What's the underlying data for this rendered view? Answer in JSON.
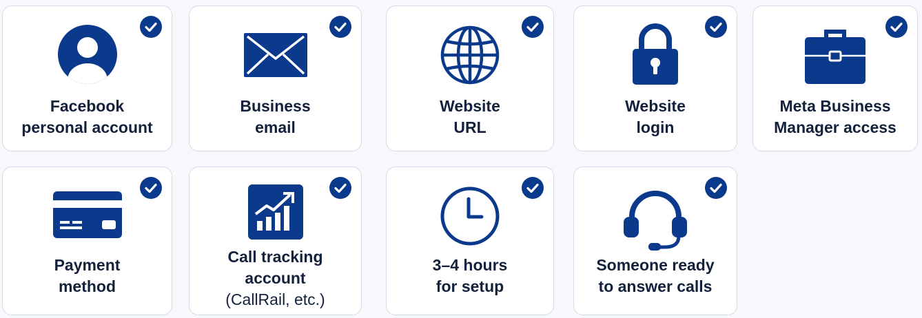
{
  "colors": {
    "icon": "#0b3a8c",
    "text": "#14213d",
    "border": "#d3dbe8",
    "check_bg": "#0b3a8c"
  },
  "cards": [
    {
      "icon": "user-circle-icon",
      "lines": [
        "Facebook",
        "personal account"
      ]
    },
    {
      "icon": "envelope-icon",
      "lines": [
        "Business",
        "email"
      ]
    },
    {
      "icon": "globe-icon",
      "lines": [
        "Website",
        "URL"
      ]
    },
    {
      "icon": "padlock-icon",
      "lines": [
        "Website",
        "login"
      ]
    },
    {
      "icon": "briefcase-icon",
      "lines": [
        "Meta Business",
        "Manager access"
      ]
    },
    {
      "icon": "credit-card-icon",
      "lines": [
        "Payment",
        "method"
      ]
    },
    {
      "icon": "growth-chart-icon",
      "lines": [
        "Call tracking",
        "account",
        "(CallRail, etc.)"
      ]
    },
    {
      "icon": "clock-icon",
      "lines": [
        "3–4 hours",
        "for setup"
      ]
    },
    {
      "icon": "headset-icon",
      "lines": [
        "Someone ready",
        "to answer calls"
      ]
    }
  ]
}
